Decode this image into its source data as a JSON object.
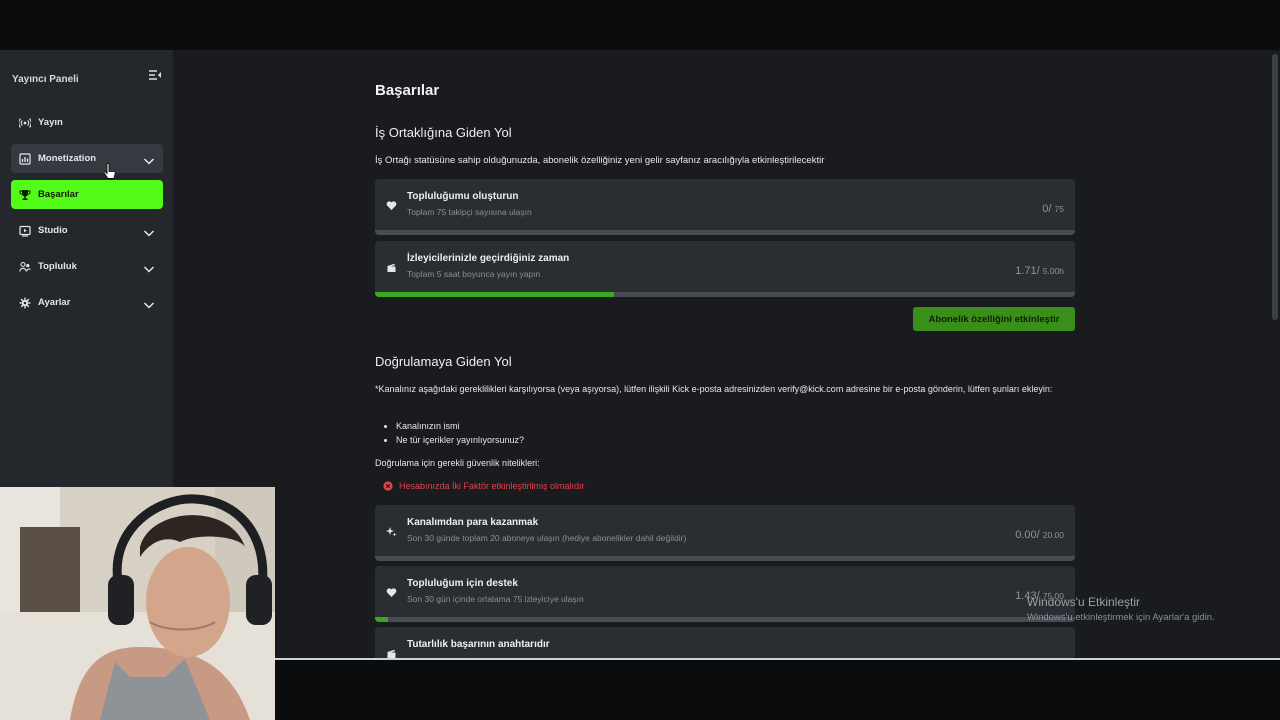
{
  "sidebar": {
    "title": "Yayıncı Paneli",
    "items": [
      {
        "label": "Yayın",
        "icon": "broadcast-icon",
        "state": "normal",
        "has_chevron": false
      },
      {
        "label": "Monetization",
        "icon": "chart-icon",
        "state": "open",
        "has_chevron": true
      },
      {
        "label": "Başarılar",
        "icon": "trophy-icon",
        "state": "active",
        "has_chevron": false
      },
      {
        "label": "Studio",
        "icon": "video-icon",
        "state": "normal",
        "has_chevron": true
      },
      {
        "label": "Topluluk",
        "icon": "users-icon",
        "state": "normal",
        "has_chevron": true
      },
      {
        "label": "Ayarlar",
        "icon": "gear-icon",
        "state": "normal",
        "has_chevron": true
      }
    ]
  },
  "main": {
    "title": "Başarılar",
    "partner": {
      "title": "İş Ortaklığına Giden Yol",
      "description": "İş Ortağı statüsüne sahip olduğunuzda, abonelik özelliğiniz yeni gelir sayfanız aracılığıyla etkinleştirilecektir",
      "cards": [
        {
          "title": "Topluluğumu oluşturun",
          "subtitle": "Toplam 75 takipçi sayısına ulaşın",
          "value": "0/",
          "target": "75",
          "progress": 0.0
        },
        {
          "title": "İzleyicilerinizle geçirdiğiniz zaman",
          "subtitle": "Toplam 5 saat boyunca yayın yapın",
          "value": "1.71/",
          "target": "5.00h",
          "progress": 0.342
        }
      ],
      "button": "Abonelik özelliğini etkinleştir"
    },
    "verify": {
      "title": "Doğrulamaya Giden Yol",
      "text": "*Kanalınız aşağıdaki gereklilikleri karşılıyorsa (veya aşıyorsa), lütfen ilişkili Kick e-posta adresinizden verify@kick.com adresine bir e-posta gönderin, lütfen şunları ekleyin:",
      "bullets": [
        "Kanalınızın ismi",
        "Ne tür içerikler yayınlıyorsunuz?"
      ],
      "requirements_title": "Doğrulama için gerekli güvenlik nitelikleri:",
      "error": "Hesabınızda İki Faktör etkinleştirilmiş olmalıdır",
      "cards": [
        {
          "title": "Kanalımdan para kazanmak",
          "subtitle": "Son 30 günde toplam 20 aboneye ulaşın (hediye abonelikler dahil değildir)",
          "value": "0.00/",
          "target": "20.00",
          "progress": 0.0
        },
        {
          "title": "Topluluğum için destek",
          "subtitle": "Son 30 gün içinde ortalama 75 izleyiciye ulaşın",
          "value": "1.43/",
          "target": "75.00",
          "progress": 0.019
        },
        {
          "title": "Tutarlılık başarının anahtarıdır",
          "subtitle": "",
          "value": "",
          "target": "",
          "progress": 0.0
        }
      ]
    }
  },
  "watermark": {
    "line1": "Windows'u Etkinleştir",
    "line2": "Windows'u etkinleştirmek için Ayarlar'a gidin."
  },
  "colors": {
    "accent": "#53fc18",
    "progress": "#3aa820",
    "error": "#e0434b",
    "card": "#2a2d32",
    "background": "#191b1f"
  }
}
